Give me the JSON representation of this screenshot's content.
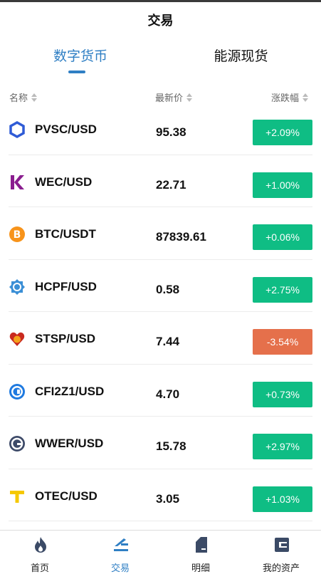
{
  "header": {
    "title": "交易"
  },
  "tabs": [
    {
      "label": "数字货币",
      "active": true
    },
    {
      "label": "能源现货",
      "active": false
    }
  ],
  "columns": {
    "name": "名称",
    "price": "最新价",
    "change": "涨跌幅"
  },
  "rows": [
    {
      "pair": "PVSC/USD",
      "price": "95.38",
      "change": "+2.09%",
      "direction": "up",
      "icon": "pvsc-icon"
    },
    {
      "pair": "WEC/USD",
      "price": "22.71",
      "change": "+1.00%",
      "direction": "up",
      "icon": "wec-icon"
    },
    {
      "pair": "BTC/USDT",
      "price": "87839.61",
      "change": "+0.06%",
      "direction": "up",
      "icon": "btc-icon"
    },
    {
      "pair": "HCPF/USD",
      "price": "0.58",
      "change": "+2.75%",
      "direction": "up",
      "icon": "hcpf-icon"
    },
    {
      "pair": "STSP/USD",
      "price": "7.44",
      "change": "-3.54%",
      "direction": "down",
      "icon": "stsp-icon"
    },
    {
      "pair": "CFI2Z1/USD",
      "price": "4.70",
      "change": "+0.73%",
      "direction": "up",
      "icon": "cfi2z1-icon"
    },
    {
      "pair": "WWER/USD",
      "price": "15.78",
      "change": "+2.97%",
      "direction": "up",
      "icon": "wwer-icon"
    },
    {
      "pair": "OTEC/USD",
      "price": "3.05",
      "change": "+1.03%",
      "direction": "up",
      "icon": "otec-icon"
    }
  ],
  "tabbar": [
    {
      "label": "首页",
      "icon": "flame-icon",
      "active": false
    },
    {
      "label": "交易",
      "icon": "trade-icon",
      "active": true
    },
    {
      "label": "明细",
      "icon": "document-icon",
      "active": false
    },
    {
      "label": "我的资产",
      "icon": "wallet-icon",
      "active": false
    }
  ],
  "colors": {
    "accent": "#2f7fc4",
    "up": "#0fbd84",
    "down": "#e5704b"
  }
}
